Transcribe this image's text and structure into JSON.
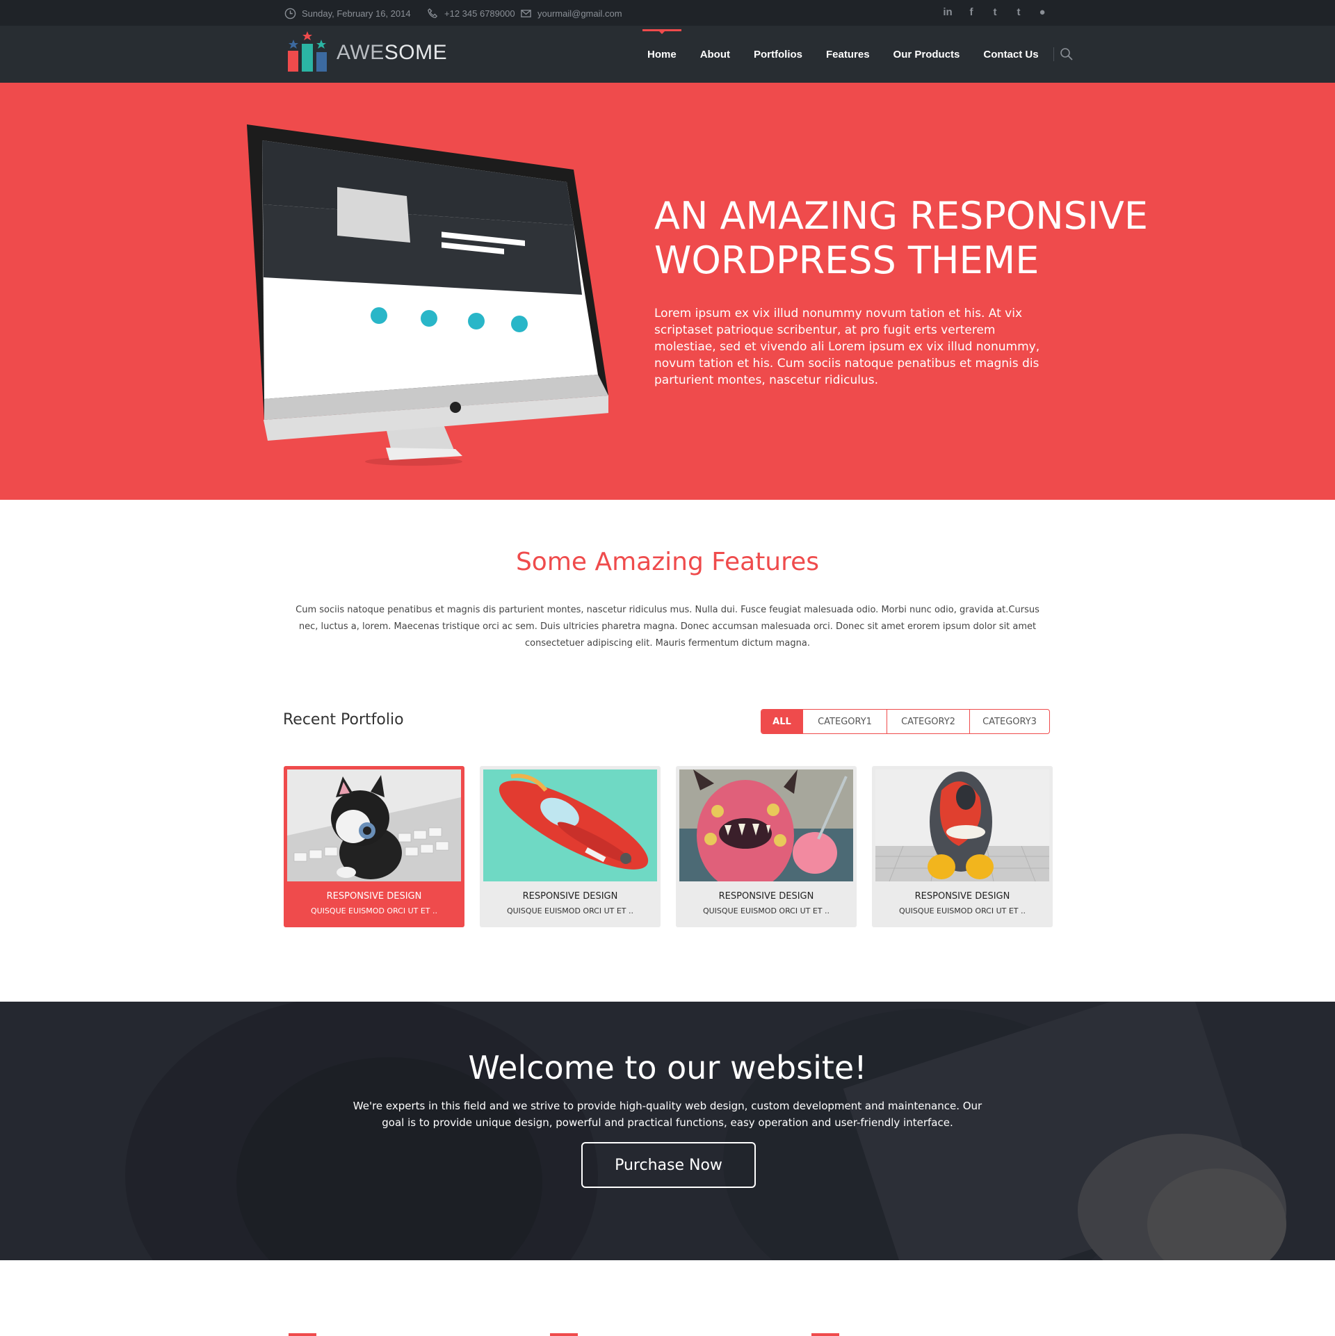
{
  "topbar": {
    "date": "Sunday, February 16, 2014",
    "phone": "+12 345 6789000",
    "email": "yourmail@gmail.com",
    "social": [
      {
        "icon": "linkedin-icon",
        "glyph": "in"
      },
      {
        "icon": "facebook-icon",
        "glyph": "f"
      },
      {
        "icon": "twitter-icon",
        "glyph": "t"
      },
      {
        "icon": "tumblr-icon",
        "glyph": "t"
      },
      {
        "icon": "flickr-icon",
        "glyph": "●"
      }
    ]
  },
  "logo": {
    "light": "AWE",
    "bold": "SOME"
  },
  "nav": {
    "items": [
      "Home",
      "About",
      "Portfolios",
      "Features",
      "Our Products",
      "Contact Us"
    ],
    "active": "Home"
  },
  "hero": {
    "title_line1": "AN AMAZING RESPONSIVE",
    "title_line2": "WORDPRESS THEME",
    "text": "Lorem ipsum ex vix illud nonummy novum tation et his. At vix scriptaset patrioque scribentur, at pro fugit erts verterem molestiae, sed et vivendo ali Lorem ipsum ex vix illud nonummy, novum tation et his. Cum sociis natoque penatibus et magnis dis parturient montes, nascetur ridiculus."
  },
  "features": {
    "title": "Some Amazing Features",
    "text": "Cum sociis natoque penatibus et magnis dis parturient montes, nascetur ridiculus mus. Nulla dui. Fusce feugiat malesuada odio. Morbi nunc odio, gravida at.Cursus nec, luctus a, lorem. Maecenas tristique orci ac sem. Duis ultricies pharetra magna. Donec accumsan malesuada orci. Donec sit amet erorem ipsum dolor sit amet consectetuer adipiscing elit. Mauris fermentum dictum magna."
  },
  "portfolio": {
    "title": "Recent Portfolio",
    "filters": [
      "ALL",
      "CATEGORY1",
      "CATEGORY2",
      "CATEGORY3"
    ],
    "active_filter": "ALL",
    "cards": [
      {
        "title": "RESPONSIVE DESIGN",
        "subtitle": "QUISQUE EUISMOD ORCI UT ET ..",
        "active": true
      },
      {
        "title": "RESPONSIVE DESIGN",
        "subtitle": "QUISQUE EUISMOD ORCI UT ET ..",
        "active": false
      },
      {
        "title": "RESPONSIVE DESIGN",
        "subtitle": "QUISQUE EUISMOD ORCI UT ET ..",
        "active": false
      },
      {
        "title": "RESPONSIVE DESIGN",
        "subtitle": "QUISQUE EUISMOD ORCI UT ET ..",
        "active": false
      }
    ]
  },
  "welcome": {
    "title": "Welcome to our website!",
    "text": "We're experts in this field and we strive to provide high-quality web design, custom development and maintenance. Our goal is to provide unique design, powerful and practical functions, easy operation and user-friendly interface.",
    "button": "Purchase Now"
  },
  "colors": {
    "accent": "#ef4b4c",
    "dark": "#282d32",
    "topbar": "#1f2328"
  }
}
